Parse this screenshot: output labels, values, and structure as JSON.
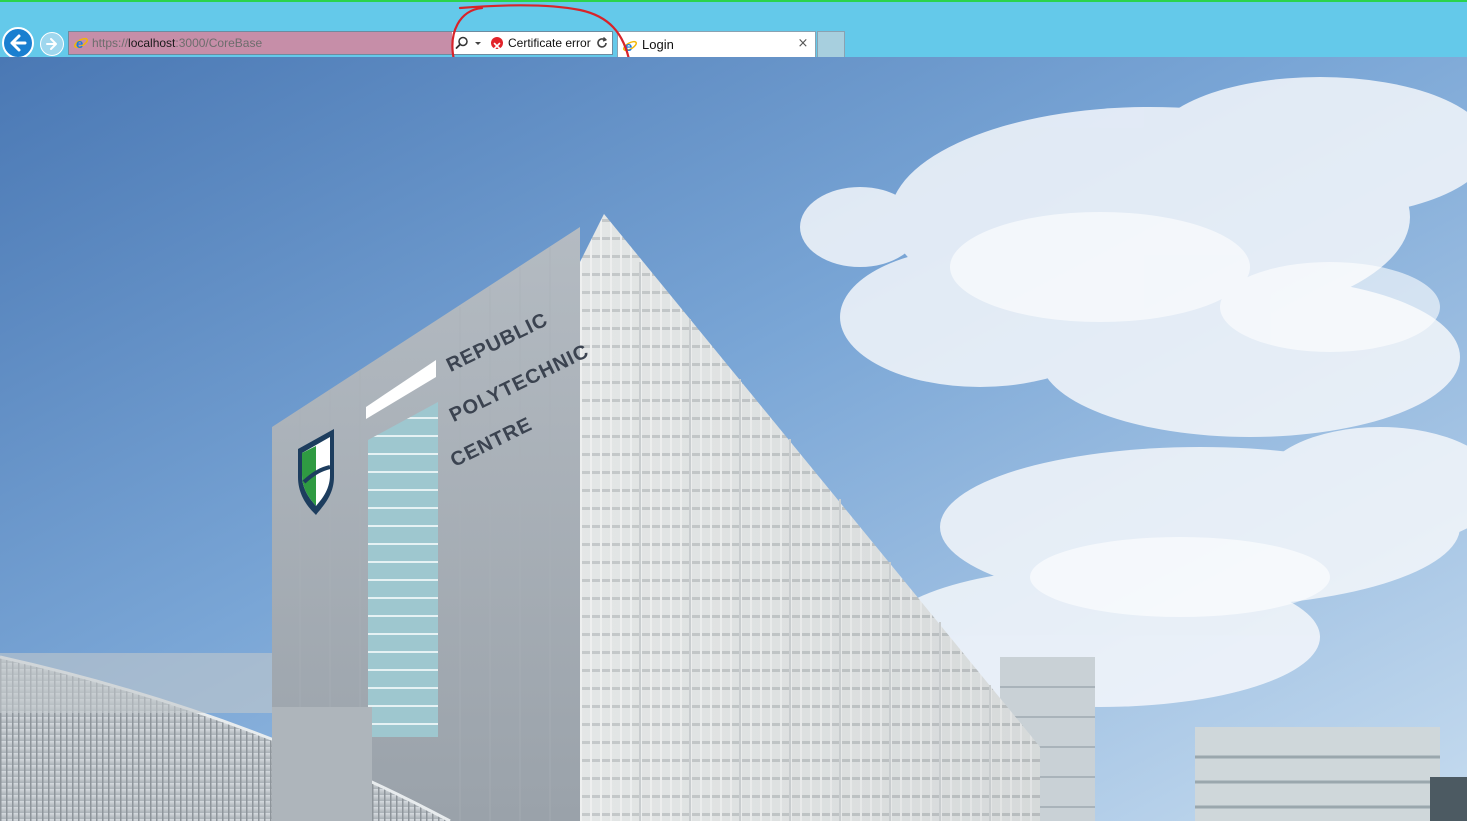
{
  "browser": {
    "address_bar": {
      "url_scheme": "https://",
      "url_host": "localhost",
      "url_rest": ":3000/CoreBase",
      "certificate_status": "Certificate error"
    },
    "tabs": [
      {
        "label": "Login",
        "active": true
      }
    ],
    "chrome_color": "#64c9ea",
    "certificate_error_color": "#e2232a"
  },
  "annotation": {
    "type": "red-circle",
    "color": "#d8232a",
    "target": "certificate-error"
  },
  "page": {
    "background": "photo of a building against a blue sky with clouds",
    "sign": {
      "line1": "REPUBLIC",
      "line2": "POLYTECHNIC",
      "line3": "CENTRE"
    }
  }
}
